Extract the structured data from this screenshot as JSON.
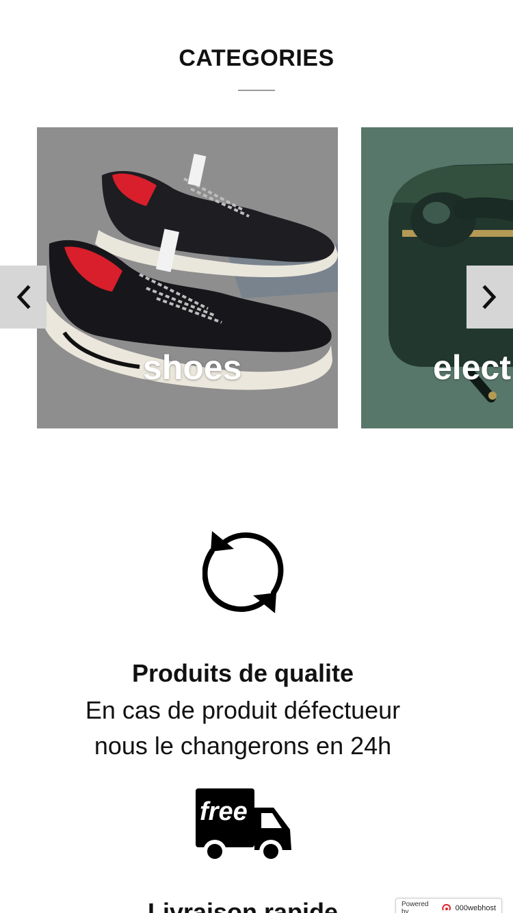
{
  "categories": {
    "title": "CATEGORIES",
    "slides": [
      {
        "label": "shoes"
      },
      {
        "label": "elect"
      }
    ],
    "prev_icon": "chevron-left-icon",
    "next_icon": "chevron-right-icon"
  },
  "features": [
    {
      "icon": "refresh-icon",
      "title": "Produits de qualite",
      "description_line1": "En cas de produit défectueur",
      "description_line2": "nous le changerons en 24h"
    },
    {
      "icon": "free-delivery-truck-icon",
      "icon_text": "free",
      "title": "Livraison rapide"
    }
  ],
  "footer_badge": {
    "prefix": "Powered by",
    "brand": "000webhost"
  },
  "colors": {
    "arrow_background": "#d6d6d6",
    "accent": "#e0242b"
  }
}
